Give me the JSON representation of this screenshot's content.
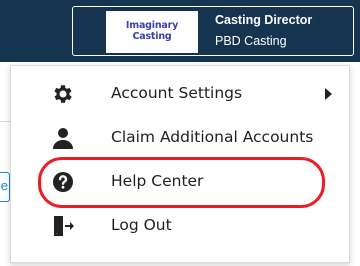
{
  "header": {
    "logo_text": "Imaginary\nCasting",
    "user_role": "Casting Director",
    "company": "PBD Casting"
  },
  "background": {
    "button_fragment": "e"
  },
  "menu": {
    "items": [
      {
        "label": "Account Settings",
        "icon": "gear-icon",
        "has_submenu": true
      },
      {
        "label": "Claim Additional Accounts",
        "icon": "person-icon",
        "has_submenu": false
      },
      {
        "label": "Help Center",
        "icon": "question-circle-icon",
        "has_submenu": false,
        "highlighted": true
      },
      {
        "label": "Log Out",
        "icon": "logout-door-icon",
        "has_submenu": false
      }
    ]
  },
  "colors": {
    "header_bg": "#15344f",
    "highlight_ring": "#ea1f25",
    "logo_text": "#3a3fb0",
    "bg_button": "#1e88c8"
  }
}
